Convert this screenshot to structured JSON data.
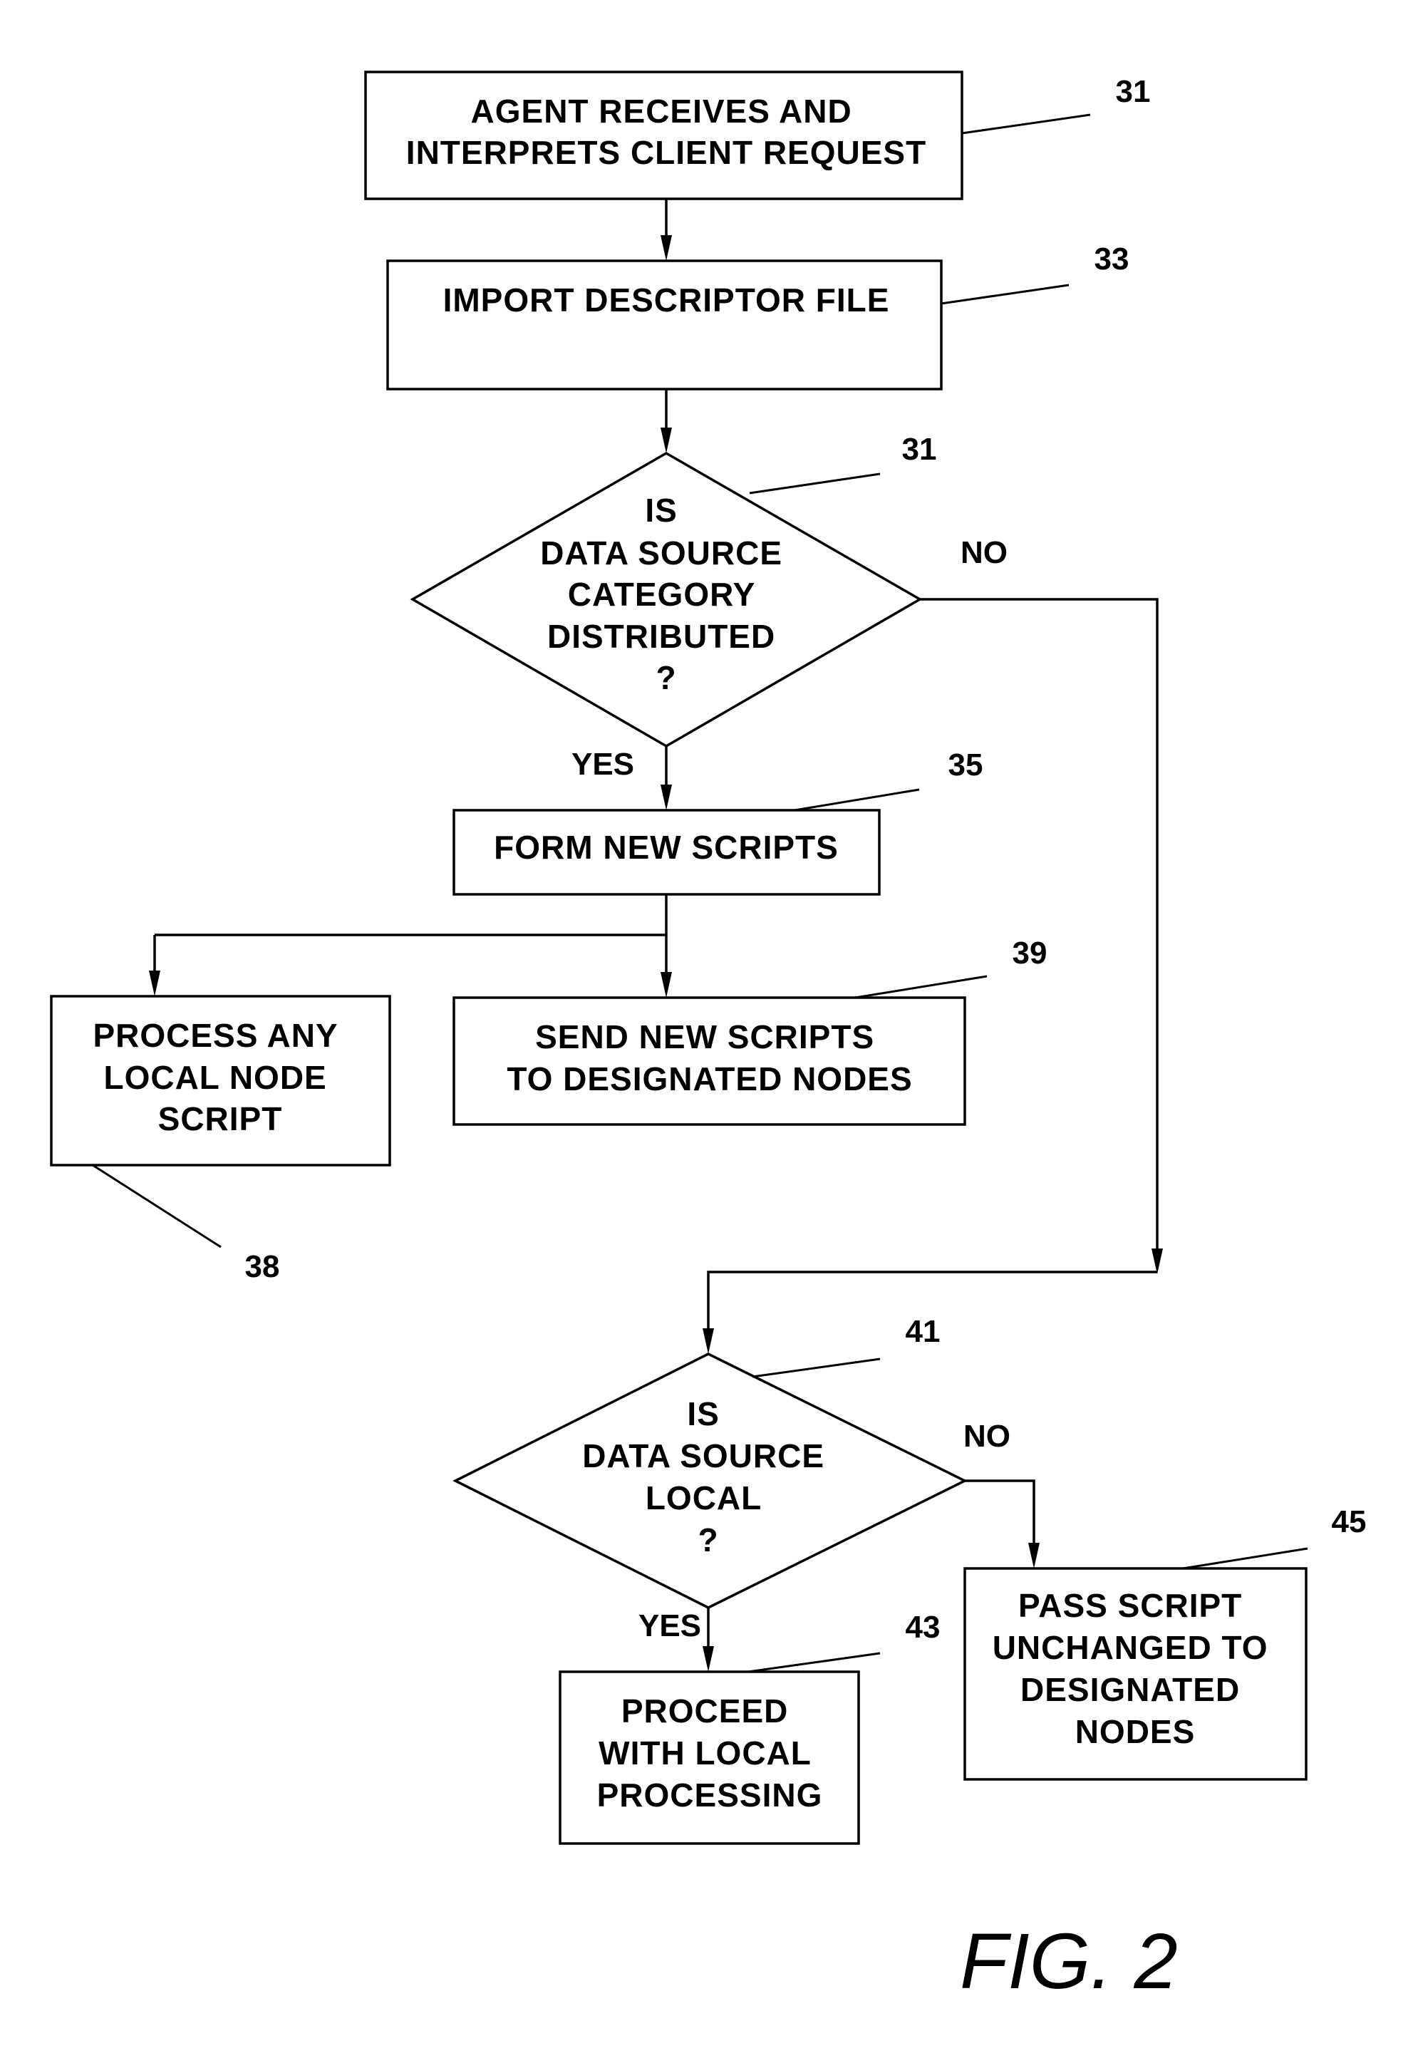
{
  "figure_label": "FIG. 2",
  "nodes": {
    "agent_receives": {
      "ref": "31",
      "lines": [
        "AGENT RECEIVES AND",
        "INTERPRETS CLIENT REQUEST"
      ]
    },
    "import_descriptor": {
      "ref": "33",
      "lines": [
        "IMPORT DESCRIPTOR FILE"
      ]
    },
    "decision_distributed": {
      "ref": "31",
      "lines": [
        "IS",
        "DATA SOURCE",
        "CATEGORY",
        "DISTRIBUTED",
        "?"
      ]
    },
    "form_new_scripts": {
      "ref": "35",
      "lines": [
        "FORM NEW SCRIPTS"
      ]
    },
    "process_local_node": {
      "ref": "38",
      "lines": [
        "PROCESS ANY",
        "LOCAL NODE",
        "SCRIPT"
      ]
    },
    "send_new_scripts": {
      "ref": "39",
      "lines": [
        "SEND NEW SCRIPTS",
        "TO DESIGNATED NODES"
      ]
    },
    "decision_local": {
      "ref": "41",
      "lines": [
        "IS",
        "DATA SOURCE",
        "LOCAL",
        "?"
      ]
    },
    "proceed_local": {
      "ref": "43",
      "lines": [
        "PROCEED",
        "WITH LOCAL",
        "PROCESSING"
      ]
    },
    "pass_script": {
      "ref": "45",
      "lines": [
        "PASS SCRIPT",
        "UNCHANGED TO",
        "DESIGNATED",
        "NODES"
      ]
    }
  },
  "branch_labels": {
    "distributed_no": "NO",
    "distributed_yes": "YES",
    "local_no": "NO",
    "local_yes": "YES"
  }
}
